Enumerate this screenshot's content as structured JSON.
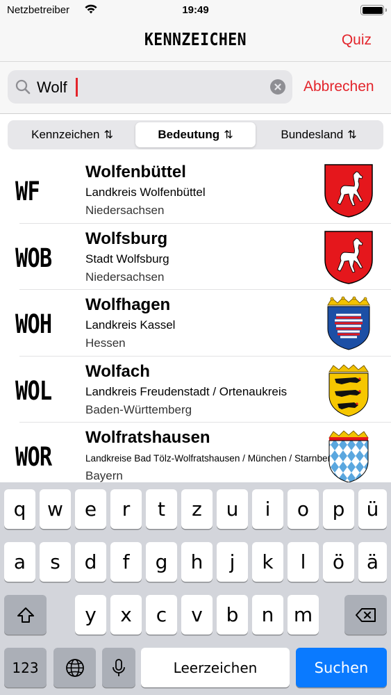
{
  "status_bar": {
    "carrier": "Netzbetreiber",
    "time": "19:49"
  },
  "nav": {
    "title": "KENNZEICHEN",
    "quiz_label": "Quiz"
  },
  "search": {
    "value": "Wolf",
    "placeholder": "",
    "cancel_label": "Abbrechen"
  },
  "segments": [
    {
      "label": "Kennzeichen",
      "active": false
    },
    {
      "label": "Bedeutung",
      "active": true
    },
    {
      "label": "Bundesland",
      "active": false
    }
  ],
  "results": [
    {
      "code": "WF",
      "name": "Wolfenbüttel",
      "district": "Landkreis Wolfenbüttel",
      "state": "Niedersachsen",
      "crest": "niedersachsen-horse-crest-icon"
    },
    {
      "code": "WOB",
      "name": "Wolfsburg",
      "district": "Stadt Wolfsburg",
      "state": "Niedersachsen",
      "crest": "niedersachsen-horse-crest-icon"
    },
    {
      "code": "WOH",
      "name": "Wolfhagen",
      "district": "Landkreis Kassel",
      "state": "Hessen",
      "crest": "hessen-lion-crest-icon"
    },
    {
      "code": "WOL",
      "name": "Wolfach",
      "district": "Landkreis Freudenstadt / Ortenaukreis",
      "state": "Baden-Württemberg",
      "crest": "baden-wuerttemberg-lions-crest-icon"
    },
    {
      "code": "WOR",
      "name": "Wolfratshausen",
      "district": "Landkreise Bad Tölz-Wolfratshausen / München / Starnberg",
      "state": "Bayern",
      "crest": "bayern-lozenges-crest-icon"
    }
  ],
  "keyboard": {
    "row1": [
      "q",
      "w",
      "e",
      "r",
      "t",
      "z",
      "u",
      "i",
      "o",
      "p",
      "ü"
    ],
    "row2": [
      "a",
      "s",
      "d",
      "f",
      "g",
      "h",
      "j",
      "k",
      "l",
      "ö",
      "ä"
    ],
    "row3": [
      "y",
      "x",
      "c",
      "v",
      "b",
      "n",
      "m"
    ],
    "numbers_label": "123",
    "space_label": "Leerzeichen",
    "search_label": "Suchen"
  },
  "colors": {
    "accent": "#e3242b",
    "keyboard_action": "#0a7aff"
  }
}
